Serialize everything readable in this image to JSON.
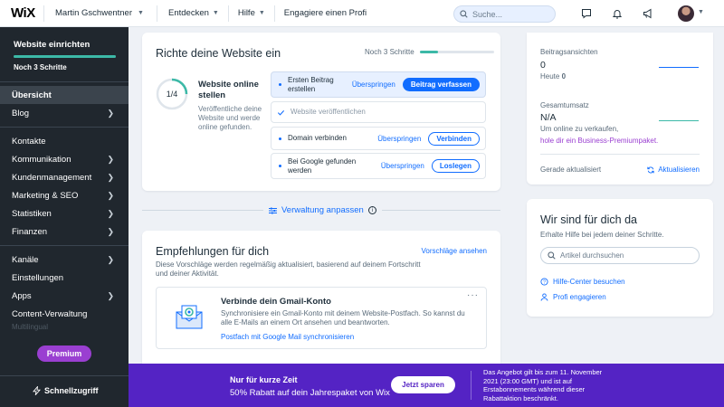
{
  "topbar": {
    "logo": "WiX",
    "user": "Martin Gschwentner",
    "nav": [
      "Entdecken",
      "Hilfe",
      "Engagiere einen Profi"
    ],
    "search_placeholder": "Suche..."
  },
  "sidebar": {
    "setup_title": "Website einrichten",
    "setup_progress": 1.0,
    "setup_sub": "Noch 3 Schritte",
    "items": [
      {
        "label": "Übersicht",
        "arrow": false
      },
      {
        "label": "Blog",
        "arrow": true
      },
      {
        "label": "Kontakte",
        "arrow": false
      },
      {
        "label": "Kommunikation",
        "arrow": true
      },
      {
        "label": "Kundenmanagement",
        "arrow": true
      },
      {
        "label": "Marketing & SEO",
        "arrow": true
      },
      {
        "label": "Statistiken",
        "arrow": true
      },
      {
        "label": "Finanzen",
        "arrow": true
      },
      {
        "label": "Kanäle",
        "arrow": true
      },
      {
        "label": "Einstellungen",
        "arrow": false
      },
      {
        "label": "Apps",
        "arrow": true
      },
      {
        "label": "Content-Verwaltung",
        "arrow": false
      }
    ],
    "faded_item": "Multilingual",
    "premium": "Premium",
    "quick_access": "Schnellzugriff"
  },
  "setup": {
    "title": "Richte deine Website ein",
    "steps_left": "Noch 3 Schritte",
    "steps_progress": 0.25,
    "ring_label": "1/4",
    "ring_progress": 0.25,
    "goal_title": "Website online stellen",
    "goal_desc": "Veröffentliche deine Website und werde online gefunden.",
    "tasks": [
      {
        "label": "Ersten Beitrag erstellen",
        "skip": "Überspringen",
        "action": "Beitrag verfassen"
      },
      {
        "label": "Website veröffentlichen"
      },
      {
        "label": "Domain verbinden",
        "skip": "Überspringen",
        "action": "Verbinden"
      },
      {
        "label": "Bei Google gefunden werden",
        "skip": "Überspringen",
        "action": "Loslegen"
      }
    ]
  },
  "manage": "Verwaltung anpassen",
  "recommendations": {
    "title": "Empfehlungen für dich",
    "see_all": "Vorschläge ansehen",
    "desc": "Diese Vorschläge werden regelmäßig aktualisiert, basierend auf deinem Fortschritt und deiner Aktivität.",
    "gmail_title": "Verbinde dein Gmail-Konto",
    "gmail_desc": "Synchronisiere ein Gmail-Konto mit deinem Website-Postfach. So kannst du alle E-Mails an einem Ort ansehen und beantworten.",
    "gmail_link": "Postfach mit Google Mail synchronisieren",
    "more": "···"
  },
  "stats": {
    "views_label": "Beitragsansichten",
    "views_value": "0",
    "today_prefix": "Heute ",
    "today_value": "0",
    "sales_label": "Gesamtumsatz",
    "sales_value": "N/A",
    "sales_sub": "Um online zu verkaufen,",
    "upgrade_link": "hole dir ein Business-Premiumpaket.",
    "updated": "Gerade aktualisiert",
    "refresh": "Aktualisieren"
  },
  "help": {
    "title": "Wir sind für dich da",
    "sub": "Erhalte Hilfe bei jedem deiner Schritte.",
    "search_placeholder": "Artikel durchsuchen",
    "link1": "Hilfe-Center besuchen",
    "link2": "Profi engagieren"
  },
  "promo": {
    "line1": "Nur für kurze Zeit",
    "line2": "50% Rabatt auf dein Jahrespaket von Wix",
    "cta": "Jetzt sparen",
    "terms": "Das Angebot gilt bis zum 11. November 2021 (23:00 GMT) und ist auf Erstabonnements während dieser Rabattaktion beschränkt."
  },
  "colors": {
    "accent": "#116dff",
    "sidebar": "#20272e",
    "premium": "#9a3fd1",
    "promo": "#5423c4",
    "progress": "#3cb9a7"
  }
}
